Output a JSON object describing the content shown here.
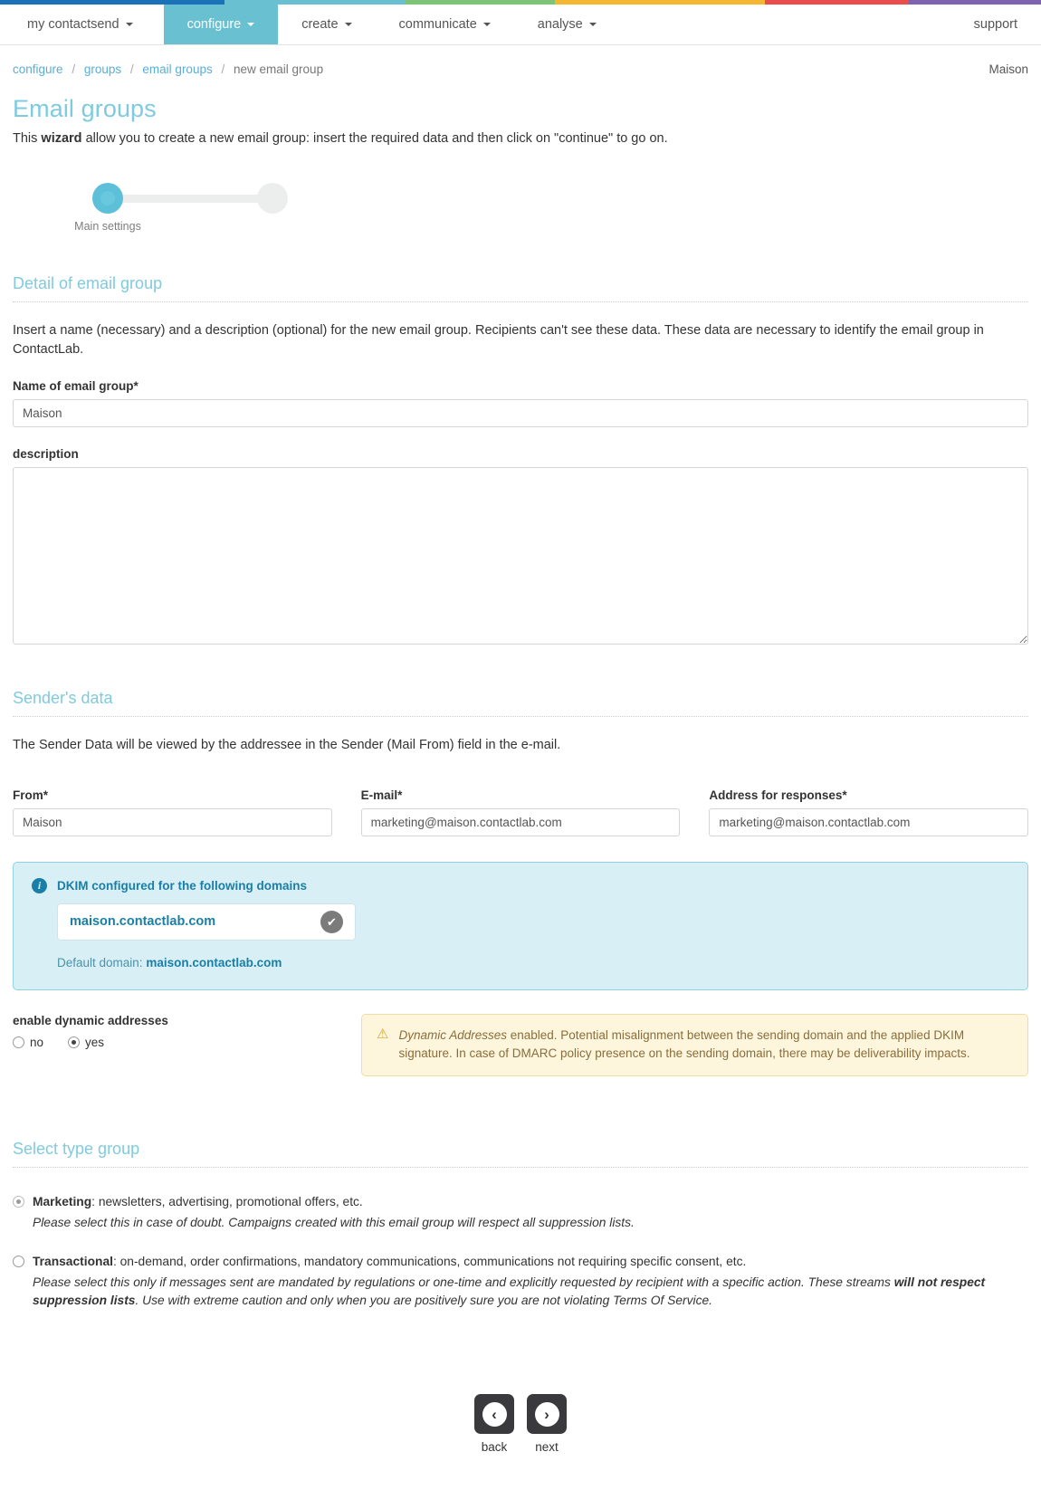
{
  "topbar": {
    "segments": [
      {
        "color": "#1c72b8",
        "flex": 23
      },
      {
        "color": "#68c0d1",
        "flex": 19
      },
      {
        "color": "#77c островов",
        "flex": 0
      }
    ]
  },
  "strip_colors": [
    "#1c72b8",
    "#68c0d1",
    "#7cc576",
    "#f5b731",
    "#ea4d4b",
    "#ffffff",
    "#8063b0"
  ],
  "nav": {
    "items": [
      {
        "label": "my contactsend",
        "caret": true,
        "active": false,
        "name": "nav-my-contactsend"
      },
      {
        "label": "configure",
        "caret": true,
        "active": true,
        "name": "nav-configure"
      },
      {
        "label": "create",
        "caret": true,
        "active": false,
        "name": "nav-create"
      },
      {
        "label": "communicate",
        "caret": true,
        "active": false,
        "name": "nav-communicate"
      },
      {
        "label": "analyse",
        "caret": true,
        "active": false,
        "name": "nav-analyse"
      }
    ],
    "support_label": "support"
  },
  "breadcrumb": {
    "items": [
      "configure",
      "groups",
      "email groups"
    ],
    "current": "new email group",
    "separator": "/",
    "user": "Maison"
  },
  "page": {
    "title": "Email groups",
    "lede_prefix": "This ",
    "lede_bold": "wizard",
    "lede_suffix": " allow you to create a new email group: insert the required data and then click on \"continue\" to go on."
  },
  "wizard": {
    "step_label": "Main settings",
    "current_step": 1,
    "total_steps": 2,
    "active_color": "#5bc0d8",
    "inactive_color": "#eceded"
  },
  "detail_section": {
    "heading": "Detail of email group",
    "intro": "Insert a name (necessary) and a description (optional) for the new email group. Recipients can't see these data. These data are necessary to identify the email group in ContactLab.",
    "name_label": "Name of email group*",
    "name_value": "Maison",
    "name_placeholder": "",
    "description_label": "description",
    "description_value": "",
    "description_placeholder": ""
  },
  "sender_section": {
    "heading": "Sender's data",
    "intro": "The Sender Data will be viewed by the addressee in the Sender (Mail From) field in the e-mail.",
    "fields": [
      {
        "label": "From*",
        "value": "Maison",
        "name": "from-field"
      },
      {
        "label": "E-mail*",
        "value": "marketing@maison.contactlab.com",
        "name": "email-field"
      },
      {
        "label": "Address for responses*",
        "value": "marketing@maison.contactlab.com",
        "name": "reply-address-field"
      }
    ]
  },
  "dkim": {
    "title": "DKIM configured for the following domains",
    "domain": "maison.contactlab.com",
    "badge_icon": "✔",
    "default_prefix": "Default domain: ",
    "default_domain": "maison.contactlab.com",
    "bg_color": "#d8eff5",
    "border_color": "#8fd2e0",
    "text_color": "#1a7fa8"
  },
  "dynamic_addresses": {
    "label": "enable dynamic addresses",
    "options": [
      {
        "label": "no",
        "checked": false
      },
      {
        "label": "yes",
        "checked": true
      }
    ],
    "warning_icon": "⚠",
    "warning_italic": "Dynamic Addresses",
    "warning_text": " enabled. Potential misalignment between the sending domain and the applied DKIM signature. In case of DMARC policy presence on the sending domain, there may be deliverability impacts.",
    "warning_bg": "#fdf6dd",
    "warning_border": "#ecdfa5",
    "warning_color": "#8a6d3b"
  },
  "type_section": {
    "heading": "Select type group",
    "options": [
      {
        "name": "Marketing",
        "title_bold": "Marketing",
        "title_rest": ": newsletters, advertising, promotional offers, etc.",
        "sub_plain_1": "Please select this in case of doubt. Campaigns created with this email group will respect all suppression lists.",
        "sub_bold": "",
        "sub_plain_2": "",
        "checked": true
      },
      {
        "name": "Transactional",
        "title_bold": "Transactional",
        "title_rest": ": on-demand, order confirmations, mandatory communications, communications not requiring specific consent, etc.",
        "sub_plain_1": "Please select this only if messages sent are mandated by regulations or one-time and explicitly requested by recipient with a specific action. These streams ",
        "sub_bold": "will not respect suppression lists",
        "sub_plain_2": ". Use with extreme caution and only when you are positively sure you are not violating Terms Of Service.",
        "checked": false
      }
    ]
  },
  "footer": {
    "back_label": "back",
    "next_label": "next",
    "back_icon": "‹",
    "next_icon": "›"
  }
}
